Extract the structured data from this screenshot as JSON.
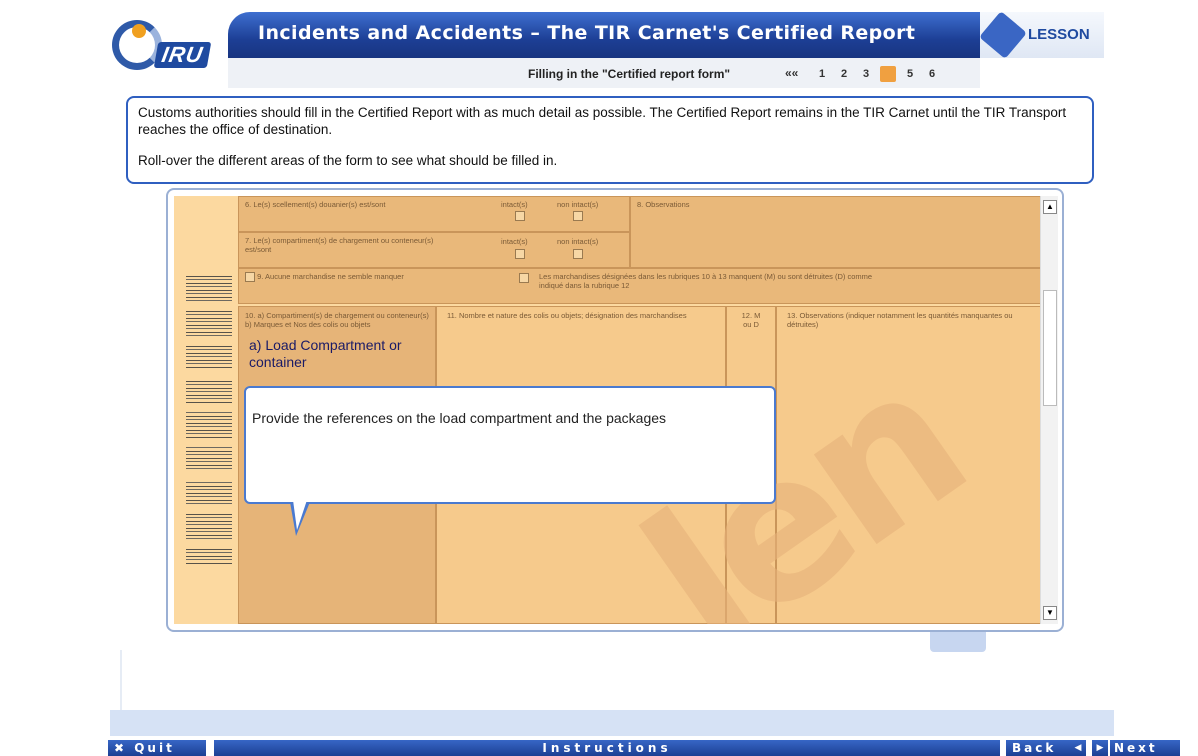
{
  "header": {
    "logo_text": "IRU",
    "title": "Incidents and Accidents – The TIR Carnet's Certified Report",
    "lesson_label": "LESSON"
  },
  "subnav": {
    "section_title": "Filling in the \"Certified report form\"",
    "rewind_label": "««",
    "pages": [
      "1",
      "2",
      "3",
      "4",
      "5",
      "6"
    ],
    "active_page": "4"
  },
  "info": {
    "paragraph1": "Customs authorities should fill in the Certified Report with as much detail as possible. The Certified Report remains in the TIR Carnet until the TIR Transport reaches the office of destination.",
    "paragraph2": "Roll-over the different areas of the form to see what should be filled in."
  },
  "form": {
    "cell6": "6. Le(s) scellement(s) douanier(s) est/sont",
    "intact": "intact(s)",
    "non_intact": "non intact(s)",
    "cell8": "8. Observations",
    "cell7": "7. Le(s) compartiment(s) de chargement ou conteneur(s) est/sont",
    "cell9": "9. Aucune marchandise ne semble manquer",
    "cell9b": "Les marchandises désignées dans les rubriques 10 à 13 manquent (M) ou sont détruites (D) comme indiqué dans la rubrique 12",
    "cell10": "10. a) Compartiment(s) de chargement ou conteneur(s) b) Marques et Nos des colis ou objets",
    "cell10_highlight": "a) Load Compartment or container",
    "cell11": "11. Nombre et nature des colis ou objets; désignation des marchandises",
    "cell12": "12. M ou D",
    "cell13": "13. Observations (indiquer notamment les quantités manquantes ou détruites)",
    "watermark": "len"
  },
  "tooltip": {
    "text": "Provide the references on the load compartment and the packages"
  },
  "footer": {
    "quit_label": "Quit",
    "instructions_label": "Instructions",
    "back_label": "Back",
    "next_label": "Next"
  }
}
